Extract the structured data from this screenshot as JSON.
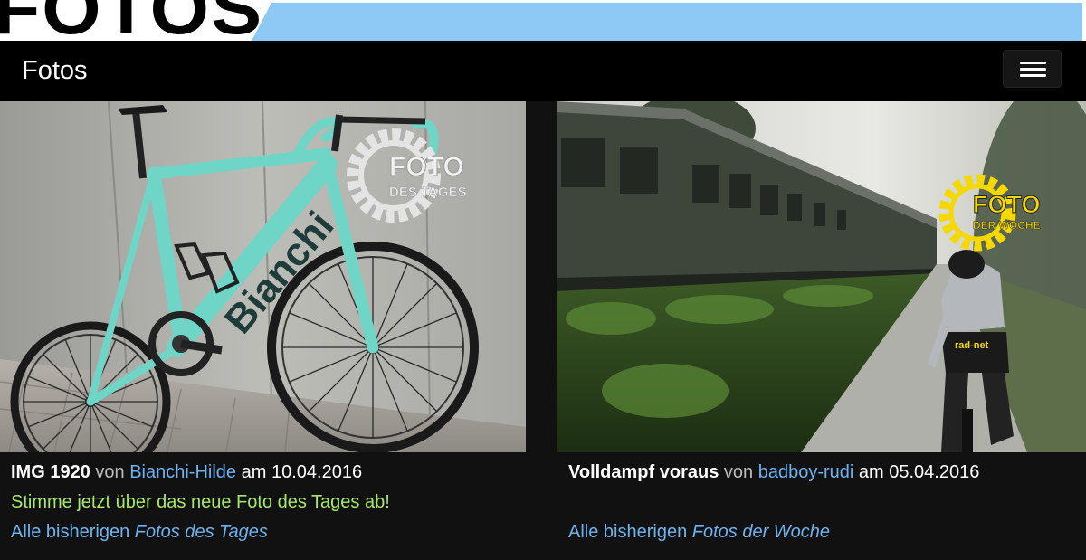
{
  "banner": {
    "logo_text": "FOTOS"
  },
  "navbar": {
    "brand": "Fotos"
  },
  "photo_of_day": {
    "badge_line1": "FOTO",
    "badge_line2": "DES TAGES",
    "frame_text": "Bianchi",
    "title": "IMG 1920",
    "by_word": "von",
    "author": "Bianchi-Hilde",
    "date_word": "am",
    "date": "10.04.2016",
    "vote_text": "Stimme jetzt über das neue Foto des Tages ab!",
    "all_link_prefix": "Alle bisherigen",
    "all_link_italic": "Fotos des Tages"
  },
  "photo_of_week": {
    "badge_line1": "FOTO",
    "badge_line2": "DER WOCHE",
    "jersey_text": "rad-net",
    "title": "Volldampf voraus",
    "by_word": "von",
    "author": "badboy-rudi",
    "date_word": "am",
    "date": "05.04.2016",
    "all_link_prefix": "Alle bisherigen",
    "all_link_italic": "Fotos der Woche"
  },
  "colors": {
    "banner_blue": "#8ec8f5",
    "link": "#6db3f0",
    "vote_green": "#a6e86c",
    "celeste": "#6fd5c6",
    "badge_yellow": "#f5d800"
  }
}
